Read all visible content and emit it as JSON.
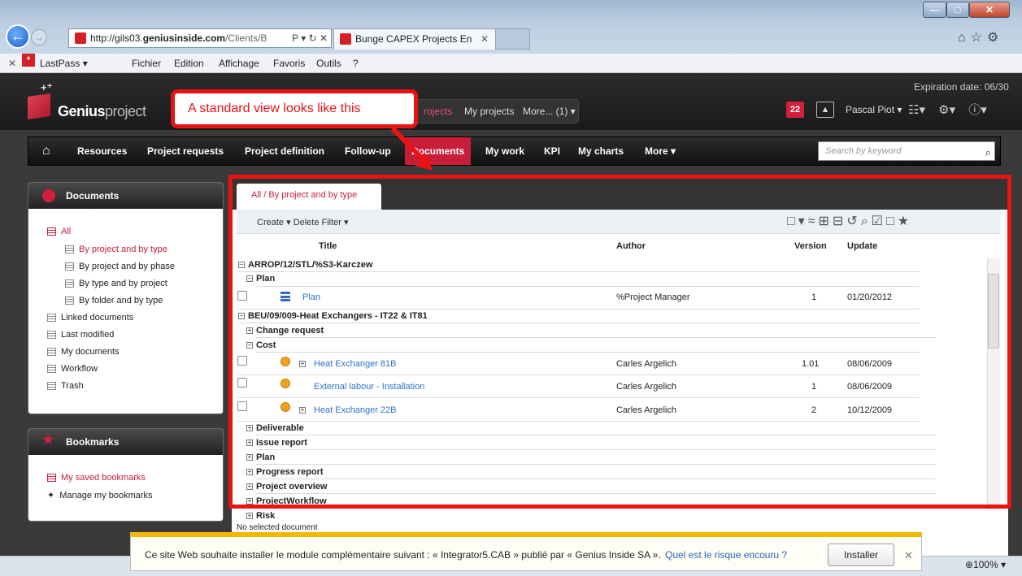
{
  "browser": {
    "url_prefix": "http://gils03.",
    "url_domain": "geniusinside.com",
    "url_rest": "/Clients/B",
    "addr_controls": "Ρ ▾ ↻ ✕",
    "tab_title": "Bunge CAPEX Projects En",
    "tab_close": "✕",
    "window_buttons": {
      "min": "—",
      "max": "□",
      "close": "✕"
    },
    "right_icons": "⌂☆⚙"
  },
  "menubar": {
    "close": "✕",
    "lastpass": "LastPass ▾",
    "items": [
      "Fichier",
      "Edition",
      "Affichage",
      "Favoris",
      "Outils",
      "?"
    ]
  },
  "app": {
    "logo_bold": "Genius",
    "logo_light": "project",
    "logo_mark": "+⁺",
    "project_bar": {
      "current": "rojects",
      "my_projects": "My projects",
      "more": "More... (1) ▾"
    },
    "expiration": "Expiration date: 06/30",
    "badge": "22",
    "user": "Pascal Piot ▾",
    "header_icons": "☷▾ ⚙▾ ⓘ▾"
  },
  "nav": {
    "home_icon": "⌂",
    "items": [
      "Resources",
      "Project requests",
      "Project definition",
      "Follow-up",
      "Documents",
      "My work",
      "KPI",
      "My charts",
      "More ▾"
    ],
    "search_placeholder": "Search by keyword",
    "search_icon": "⌕"
  },
  "callout": "A standard view looks like this",
  "documents_panel": {
    "title": "Documents",
    "items": [
      "All",
      "By project and by type",
      "By project and by phase",
      "By type and by project",
      "By folder and by type",
      "Linked documents",
      "Last modified",
      "My documents",
      "Workflow",
      "Trash"
    ]
  },
  "bookmarks_panel": {
    "title": "Bookmarks",
    "items": [
      "My saved bookmarks",
      "Manage my bookmarks"
    ]
  },
  "main": {
    "tab": "All / By project and by type",
    "toolbar": "Create ▾  Delete  Filter ▾",
    "tool_icons": "□▾≈⊞⊟↺⌕☑□★",
    "columns": {
      "title": "Title",
      "author": "Author",
      "version": "Version",
      "update": "Update"
    },
    "groups": [
      "ARROP/12/STL/%S3-Karczew",
      "Plan",
      "BEU/09/009-Heat Exchangers - IT22 & IT81",
      "Change request",
      "Cost",
      "Deliverable",
      "Issue report",
      "Plan",
      "Progress report",
      "Project overview",
      "ProjectWorkflow",
      "Risk"
    ],
    "rows": [
      {
        "title": "Plan",
        "author": "%Project Manager",
        "version": "1",
        "update": "01/20/2012"
      },
      {
        "title": "Heat Exchanger 81B",
        "author": "Carles Argelich",
        "version": "1.01",
        "update": "08/06/2009"
      },
      {
        "title": "External labour - Installation",
        "author": "Carles Argelich",
        "version": "1",
        "update": "08/06/2009"
      },
      {
        "title": "Heat Exchanger 22B",
        "author": "Carles Argelich",
        "version": "2",
        "update": "10/12/2009"
      }
    ],
    "status": "No selected document"
  },
  "infobar": {
    "text": "Ce site Web souhaite installer le module complémentaire suivant : « Integrator5.CAB » publié par « Genius Inside SA ».",
    "link": "Quel est le risque encouru ?",
    "button": "Installer",
    "close": "✕"
  },
  "zoom": "⊕100%  ▾"
}
